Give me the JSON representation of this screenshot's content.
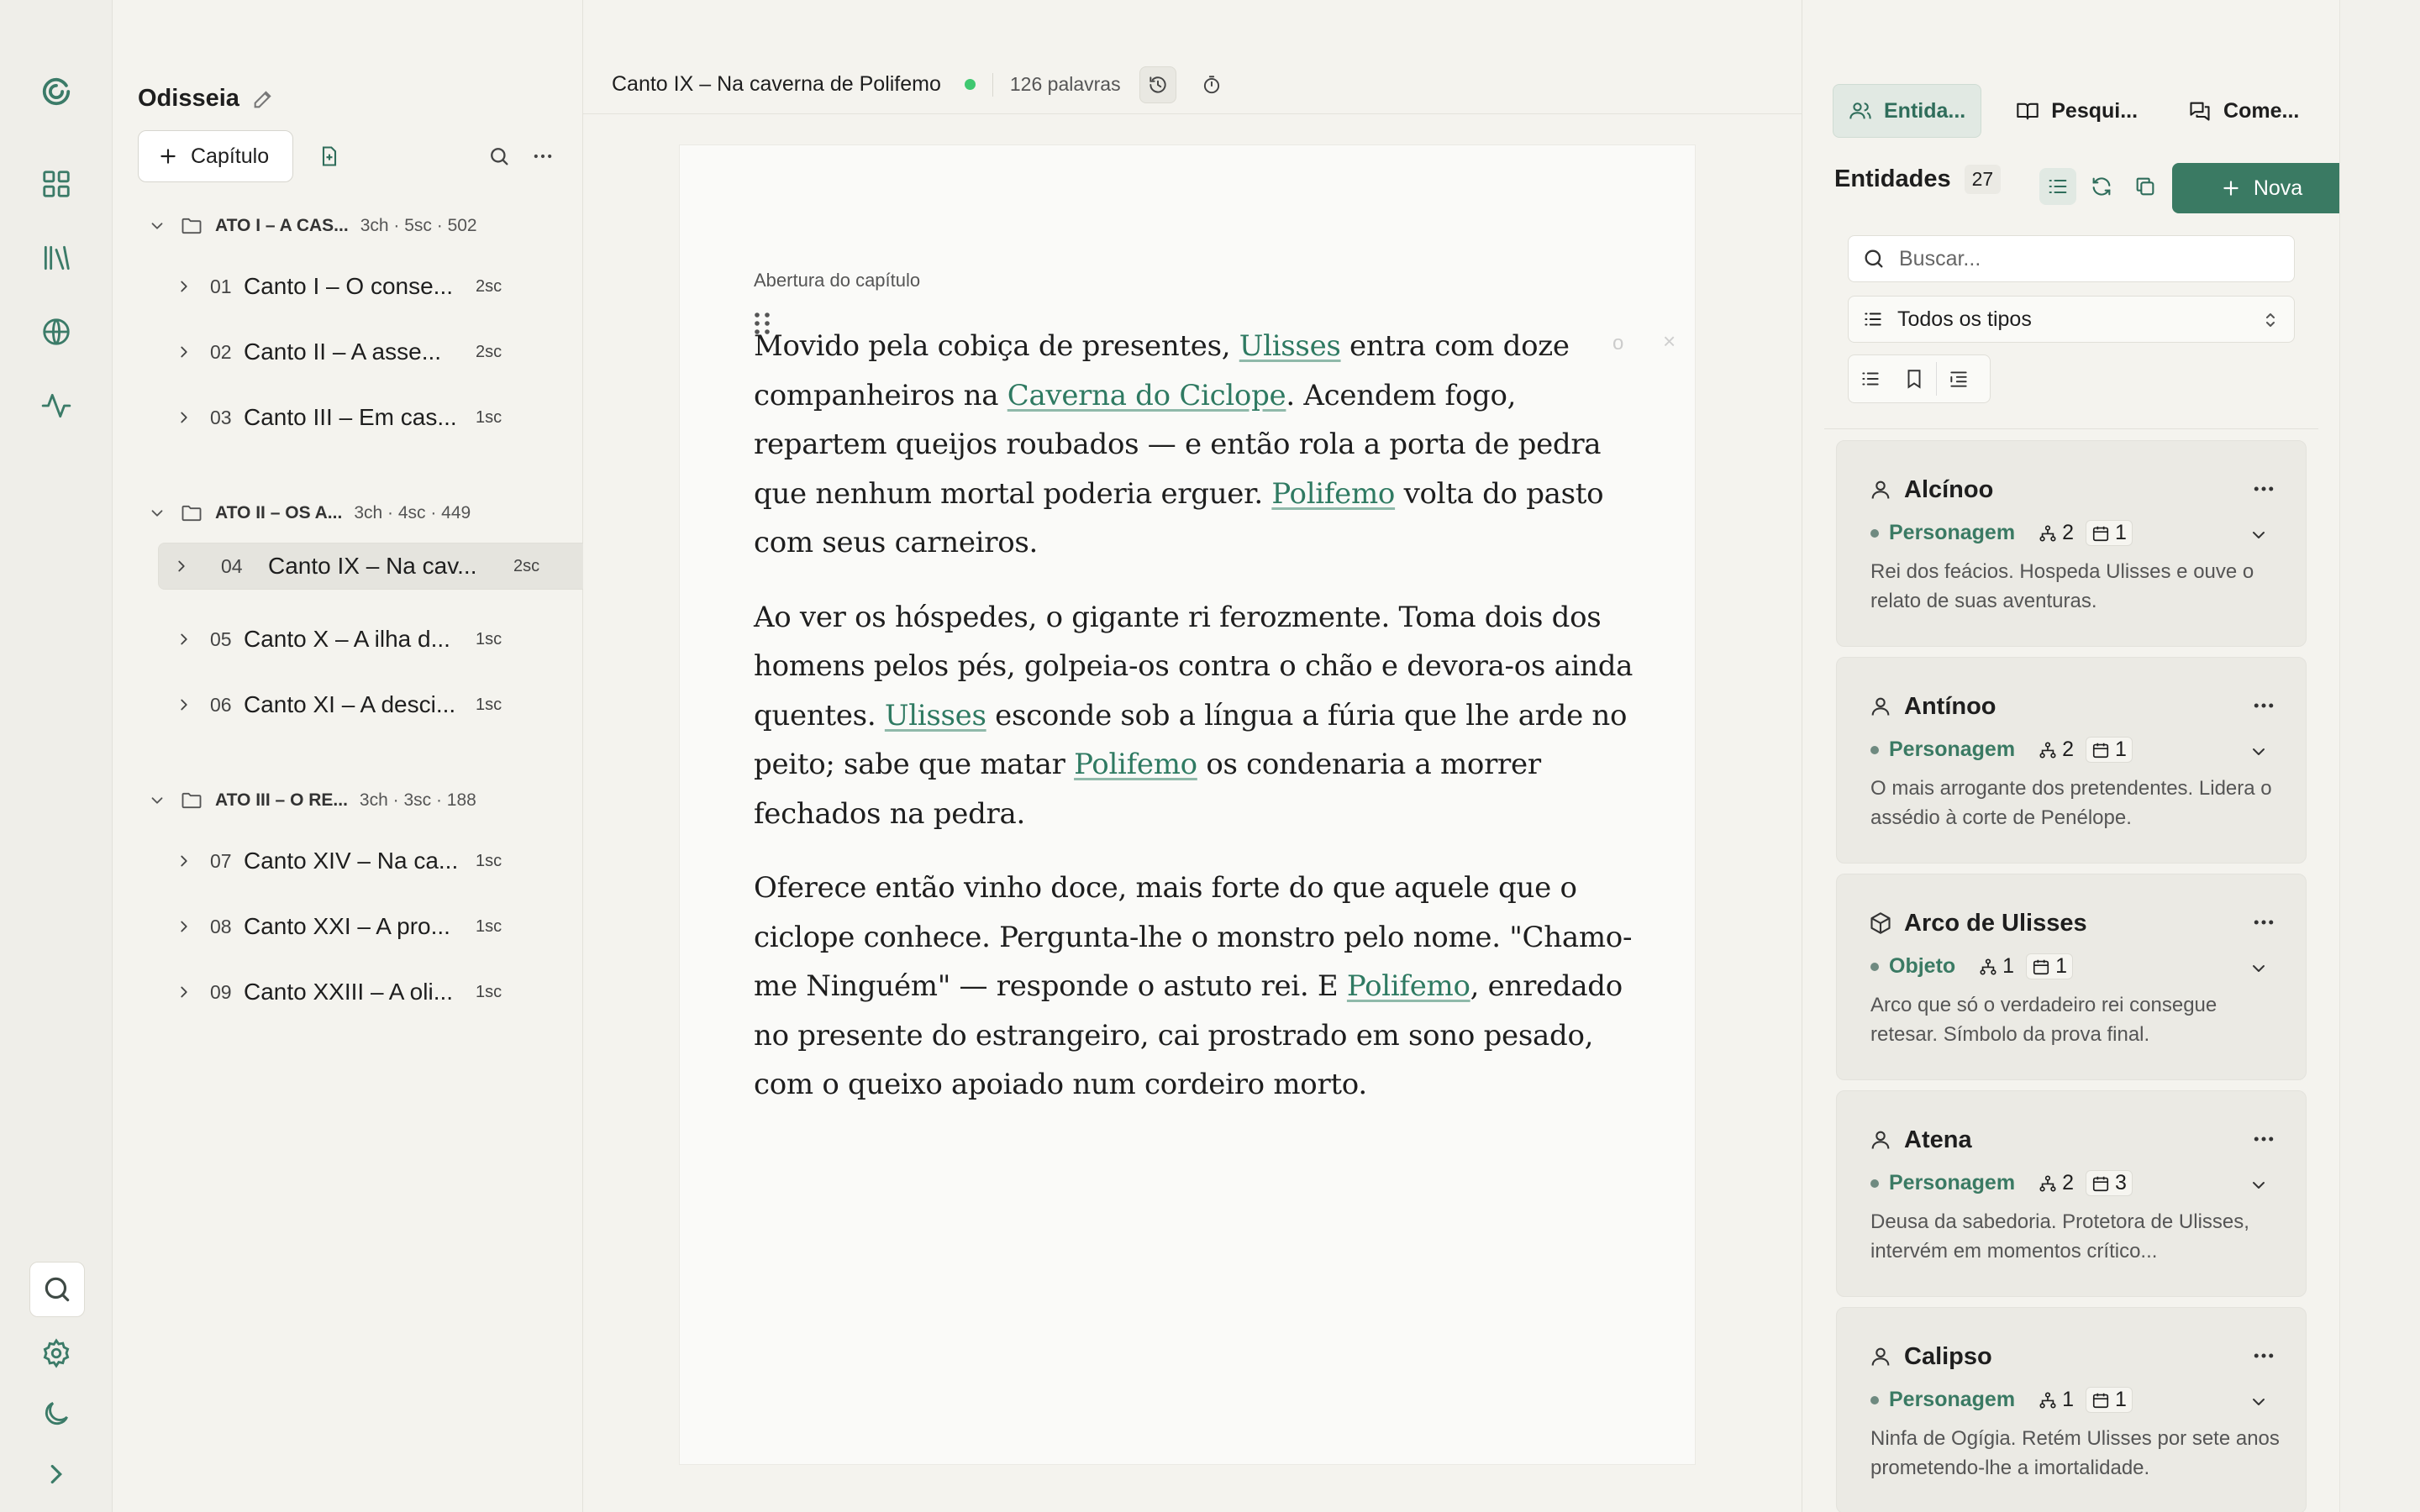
{
  "project": {
    "title": "Odisseia",
    "add_chapter_label": "Capítulo"
  },
  "tree": {
    "acts": [
      {
        "name": "ATO I – A CAS...",
        "meta": "3ch · 5sc · 502",
        "chapters": [
          {
            "num": "01",
            "name": "Canto I – O conse...",
            "scenes": "2sc",
            "selected": false
          },
          {
            "num": "02",
            "name": "Canto II – A asse...",
            "scenes": "2sc",
            "selected": false
          },
          {
            "num": "03",
            "name": "Canto III – Em cas...",
            "scenes": "1sc",
            "selected": false
          }
        ]
      },
      {
        "name": "ATO II – OS A...",
        "meta": "3ch · 4sc · 449",
        "chapters": [
          {
            "num": "04",
            "name": "Canto IX – Na cav...",
            "scenes": "2sc",
            "selected": true
          },
          {
            "num": "05",
            "name": "Canto X – A ilha d...",
            "scenes": "1sc",
            "selected": false
          },
          {
            "num": "06",
            "name": "Canto XI – A desci...",
            "scenes": "1sc",
            "selected": false
          }
        ]
      },
      {
        "name": "ATO III – O RE...",
        "meta": "3ch · 3sc · 188",
        "chapters": [
          {
            "num": "07",
            "name": "Canto XIV – Na ca...",
            "scenes": "1sc",
            "selected": false
          },
          {
            "num": "08",
            "name": "Canto XXI – A pro...",
            "scenes": "1sc",
            "selected": false
          },
          {
            "num": "09",
            "name": "Canto XXIII – A oli...",
            "scenes": "1sc",
            "selected": false
          }
        ]
      }
    ]
  },
  "editor": {
    "chapter_title": "Canto IX – Na caverna de Polifemo",
    "word_count": "126 palavras",
    "section_label": "Abertura do capítulo",
    "ghost_text": "o",
    "ghost_x": "×",
    "paragraphs": [
      [
        {
          "t": "Movido pela cobiça de presentes, "
        },
        {
          "t": "Ulisses",
          "link": true
        },
        {
          "t": " entra com doze companheiros na "
        },
        {
          "t": "Caverna do Ciclope",
          "link": true
        },
        {
          "t": ". Acendem fogo, repartem queijos roubados — e então rola a porta de pedra que nenhum mortal poderia erguer. "
        },
        {
          "t": "Polifemo",
          "link": true
        },
        {
          "t": " volta do pasto com seus carneiros."
        }
      ],
      [
        {
          "t": "Ao ver os hóspedes, o gigante ri ferozmente. Toma dois dos homens pelos pés, golpeia-os contra o chão e devora-os ainda quentes. "
        },
        {
          "t": "Ulisses",
          "link": true
        },
        {
          "t": " esconde sob a língua a fúria que lhe arde no peito; sabe que matar "
        },
        {
          "t": "Polifemo",
          "link": true
        },
        {
          "t": " os condenaria a morrer fechados na pedra."
        }
      ],
      [
        {
          "t": "Oferece então vinho doce, mais forte do que aquele que o ciclope conhece. Pergunta-lhe o monstro pelo nome. \"Chamo-me Ninguém\" — responde o astuto rei. E "
        },
        {
          "t": "Polifemo",
          "link": true
        },
        {
          "t": ", enredado no presente do estrangeiro, cai prostrado em sono pesado, com o queixo apoiado num cordeiro morto."
        }
      ]
    ]
  },
  "panel": {
    "tabs": [
      {
        "label": "Entida...",
        "icon": "users-icon",
        "active": true
      },
      {
        "label": "Pesqui...",
        "icon": "book-open-icon",
        "active": false
      },
      {
        "label": "Come...",
        "icon": "comments-icon",
        "active": false
      }
    ],
    "title": "Entidades",
    "count": "27",
    "new_label": "Nova",
    "search_placeholder": "Buscar...",
    "type_filter": "Todos os tipos",
    "entities": [
      {
        "name": "Alcínoo",
        "icon": "person-icon",
        "type": "Personagem",
        "relations": "2",
        "appearances": "1",
        "desc": "Rei dos feácios. Hospeda Ulisses e ouve o relato de suas aventuras."
      },
      {
        "name": "Antínoo",
        "icon": "person-icon",
        "type": "Personagem",
        "relations": "2",
        "appearances": "1",
        "desc": "O mais arrogante dos pretendentes. Lidera o assédio à corte de Penélope."
      },
      {
        "name": "Arco de Ulisses",
        "icon": "box-icon",
        "type": "Objeto",
        "relations": "1",
        "appearances": "1",
        "desc": "Arco que só o verdadeiro rei consegue retesar. Símbolo da prova final."
      },
      {
        "name": "Atena",
        "icon": "person-icon",
        "type": "Personagem",
        "relations": "2",
        "appearances": "3",
        "desc": "Deusa da sabedoria. Protetora de Ulisses, intervém em momentos crítico..."
      },
      {
        "name": "Calipso",
        "icon": "person-icon",
        "type": "Personagem",
        "relations": "1",
        "appearances": "1",
        "desc": "Ninfa de Ogígia. Retém Ulisses por sete anos prometendo-lhe a imortalidade."
      }
    ]
  },
  "colors": {
    "accent": "#3a7a63",
    "link": "#2f7a62",
    "status_dot": "#3fc870",
    "background": "#f4f3ee"
  }
}
